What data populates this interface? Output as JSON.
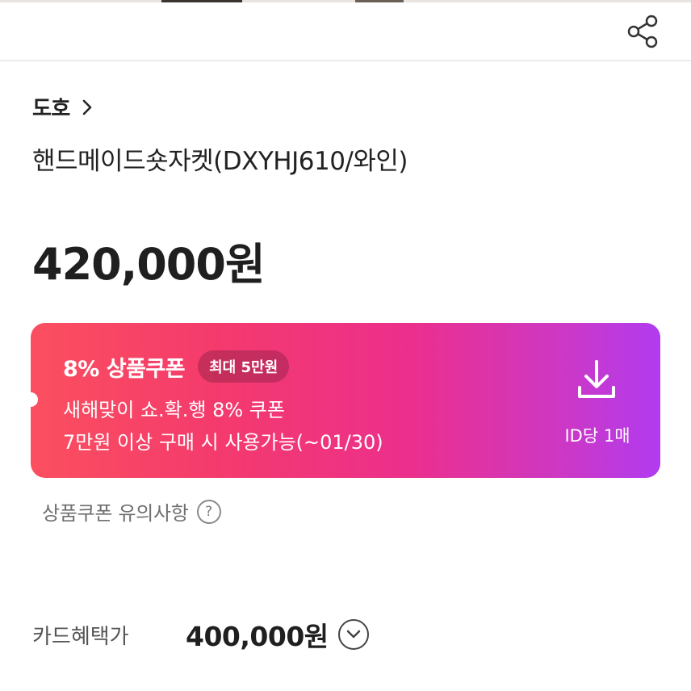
{
  "header": {
    "share_icon": "share-icon"
  },
  "brand": {
    "name": "도호",
    "chevron_icon": "chevron-right-icon"
  },
  "product": {
    "title": "핸드메이드숏자켓(DXYHJ610/와인)",
    "price": "420,000원"
  },
  "coupon": {
    "title": "8% 상품쿠폰",
    "max_badge": "최대 5만원",
    "description_line1": "새해맞이 쇼.확.행 8% 쿠폰",
    "description_line2": "7만원 이상 구매 시 사용가능(~01/30)",
    "download_icon": "download-icon",
    "limit": "ID당 1매",
    "gradient_colors": [
      "#fb4f5f",
      "#ec2f8c",
      "#b13bf0"
    ]
  },
  "coupon_notice": {
    "text": "상품쿠폰 유의사항",
    "help_icon": "?"
  },
  "card_benefit": {
    "label": "카드혜택가",
    "price": "400,000원",
    "expand_icon": "chevron-down-circle-icon"
  }
}
